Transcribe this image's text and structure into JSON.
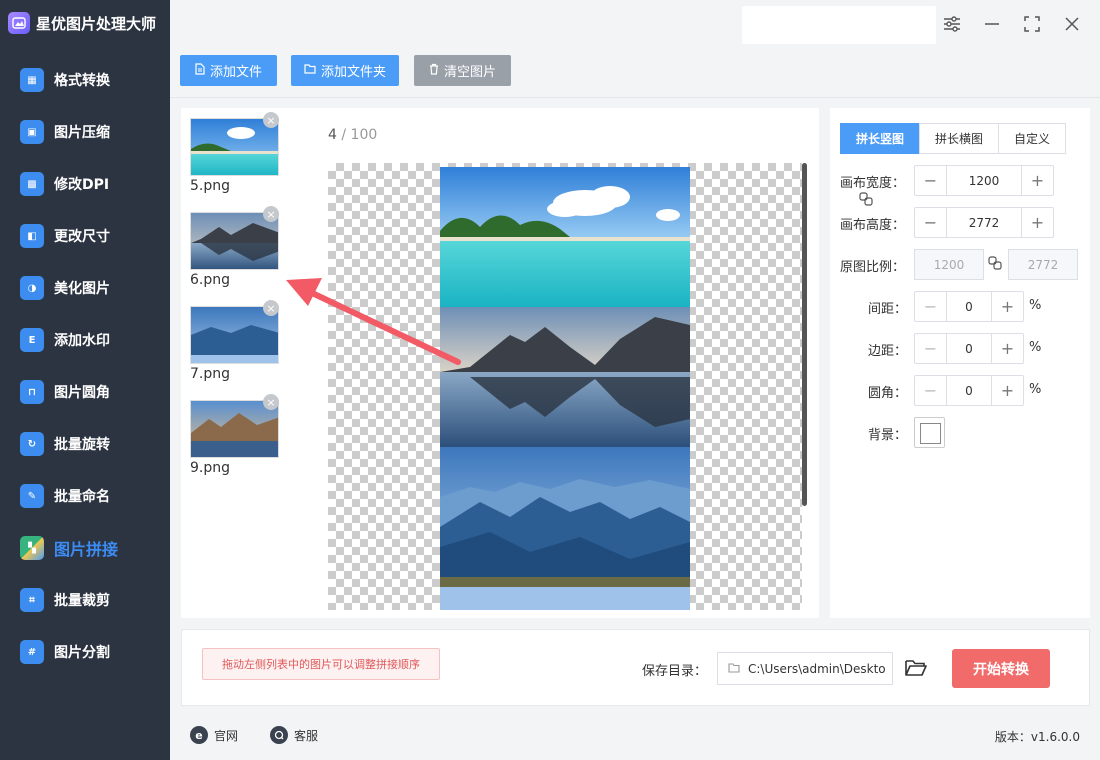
{
  "app": {
    "title": "星优图片处理大师"
  },
  "sidebar": {
    "items": [
      {
        "label": "格式转换",
        "icon": "format-convert-icon",
        "color": "#3d8cf0"
      },
      {
        "label": "图片压缩",
        "icon": "image-compress-icon",
        "color": "#3d8cf0"
      },
      {
        "label": "修改DPI",
        "icon": "dpi-icon",
        "color": "#3d8cf0"
      },
      {
        "label": "更改尺寸",
        "icon": "resize-icon",
        "color": "#3d8cf0"
      },
      {
        "label": "美化图片",
        "icon": "beautify-icon",
        "color": "#3d8cf0"
      },
      {
        "label": "添加水印",
        "icon": "watermark-icon",
        "color": "#3d8cf0"
      },
      {
        "label": "图片圆角",
        "icon": "round-corner-icon",
        "color": "#3d8cf0"
      },
      {
        "label": "批量旋转",
        "icon": "rotate-icon",
        "color": "#3d8cf0"
      },
      {
        "label": "批量命名",
        "icon": "rename-icon",
        "color": "#3d8cf0"
      },
      {
        "label": "图片拼接",
        "icon": "stitch-icon",
        "color": "#3d8cf0",
        "active": true
      },
      {
        "label": "批量裁剪",
        "icon": "crop-icon",
        "color": "#3d8cf0"
      },
      {
        "label": "图片分割",
        "icon": "split-icon",
        "color": "#3d8cf0"
      }
    ]
  },
  "toolbar": {
    "add_file": "添加文件",
    "add_folder": "添加文件夹",
    "clear_images": "清空图片"
  },
  "files": [
    {
      "name": "5.png",
      "kind": "beach"
    },
    {
      "name": "6.png",
      "kind": "lake"
    },
    {
      "name": "7.png",
      "kind": "blue-mountains"
    },
    {
      "name": "9.png",
      "kind": "sunset-mountains"
    }
  ],
  "counter": {
    "current": "4",
    "separator": " / ",
    "total": "100"
  },
  "settings": {
    "tabs": [
      "拼长竖图",
      "拼长横图",
      "自定义"
    ],
    "active_tab": 0,
    "canvas_width_label": "画布宽度：",
    "canvas_width": "1200",
    "canvas_height_label": "画布高度：",
    "canvas_height": "2772",
    "ratio_label": "原图比例：",
    "ratio_width": "1200",
    "ratio_height": "2772",
    "spacing_label": "间距：",
    "spacing": "0",
    "margin_label": "边距：",
    "margin": "0",
    "radius_label": "圆角：",
    "radius": "0",
    "percent": "%",
    "background_label": "背景：",
    "background_color": "#ffffff"
  },
  "bottom": {
    "hint": "拖动左侧列表中的图片可以调整拼接顺序",
    "save_label": "保存目录：",
    "save_path": "C:\\Users\\admin\\Deskto",
    "start_button": "开始转换"
  },
  "footer": {
    "website": "官网",
    "support": "客服",
    "version": "版本：v1.6.0.0"
  },
  "colors": {
    "accent": "#4b9cf7",
    "danger": "#f26b6b",
    "sidebar": "#2d3441",
    "arrow": "#f25a66"
  }
}
